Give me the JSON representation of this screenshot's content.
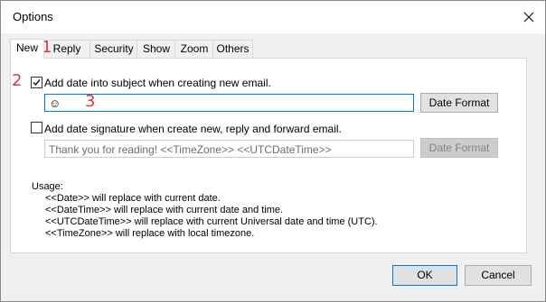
{
  "window": {
    "title": "Options"
  },
  "tabs": [
    {
      "label": "New"
    },
    {
      "label": "Reply"
    },
    {
      "label": "Security"
    },
    {
      "label": "Show"
    },
    {
      "label": "Zoom"
    },
    {
      "label": "Others"
    }
  ],
  "options": {
    "add_date": {
      "label": "Add date into subject when creating new email.",
      "checked": true,
      "value": "☺",
      "button": "Date Format"
    },
    "add_signature": {
      "label": "Add date signature when create new, reply and forward email.",
      "checked": false,
      "placeholder": "Thank you for reading!  <<TimeZone>> <<UTCDateTime>>",
      "button": "Date Format"
    }
  },
  "usage": {
    "heading": "Usage:",
    "lines": [
      "<<Date>> will replace with current date.",
      "<<DateTime>> will replace with current date and time.",
      "<<UTCDateTime>> will replace with current Universal date and time (UTC).",
      "<<TimeZone>> will replace with local timezone."
    ]
  },
  "footer": {
    "ok": "OK",
    "cancel": "Cancel"
  },
  "annotations": {
    "one": "1",
    "two": "2",
    "three": "3"
  },
  "colors": {
    "accent": "#0078d7",
    "marker": "#d83b3b"
  }
}
